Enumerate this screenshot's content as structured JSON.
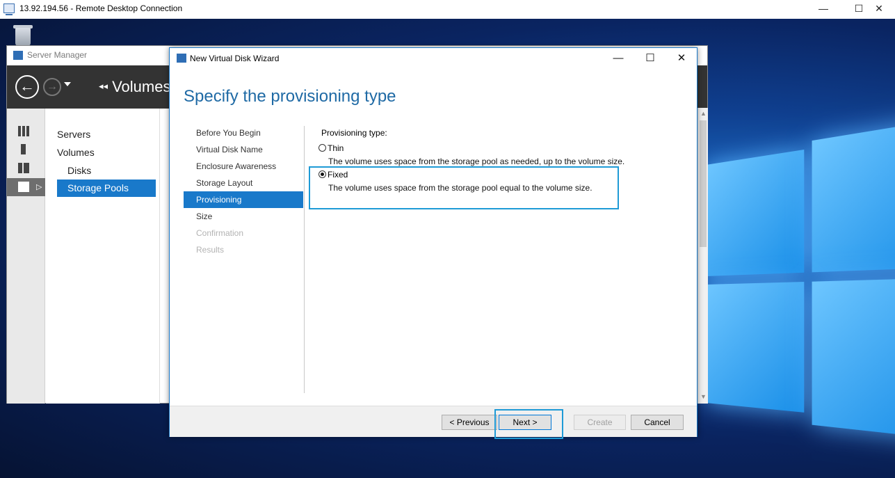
{
  "rdp": {
    "title": "13.92.194.56 - Remote Desktop Connection",
    "controls": {
      "minimize": "—",
      "maximize": "☐",
      "close": "✕"
    }
  },
  "server_manager": {
    "title": "Server Manager",
    "breadcrumb": "Volumes",
    "breadcrumb_arrows": "◂◂",
    "nav": {
      "back": "←",
      "forward": "→"
    },
    "tree": {
      "servers": "Servers",
      "volumes": "Volumes",
      "disks": "Disks",
      "storage_pools": "Storage Pools"
    },
    "rail_icons": [
      "dashboard-icon",
      "local-server-icon",
      "all-servers-icon",
      "file-storage-icon"
    ]
  },
  "wizard": {
    "title": "New Virtual Disk Wizard",
    "controls": {
      "minimize": "—",
      "maximize": "☐",
      "close": "✕"
    },
    "heading": "Specify the provisioning type",
    "steps": [
      {
        "label": "Before You Begin",
        "state": "normal"
      },
      {
        "label": "Virtual Disk Name",
        "state": "normal"
      },
      {
        "label": "Enclosure Awareness",
        "state": "normal"
      },
      {
        "label": "Storage Layout",
        "state": "normal"
      },
      {
        "label": "Provisioning",
        "state": "active"
      },
      {
        "label": "Size",
        "state": "normal"
      },
      {
        "label": "Confirmation",
        "state": "disabled"
      },
      {
        "label": "Results",
        "state": "disabled"
      }
    ],
    "provisioning_label": "Provisioning type:",
    "options": [
      {
        "label": "Thin",
        "description": "The volume uses space from the storage pool as needed, up to the volume size.",
        "selected": false
      },
      {
        "label": "Fixed",
        "description": "The volume uses space from the storage pool equal to the volume size.",
        "selected": true
      }
    ],
    "buttons": {
      "previous": "< Previous",
      "next": "Next >",
      "create": "Create",
      "cancel": "Cancel"
    }
  },
  "colors": {
    "accent": "#1979ca",
    "highlight_outline": "#1e9ad6",
    "heading": "#1f6aa5",
    "sm_header": "#333333"
  }
}
